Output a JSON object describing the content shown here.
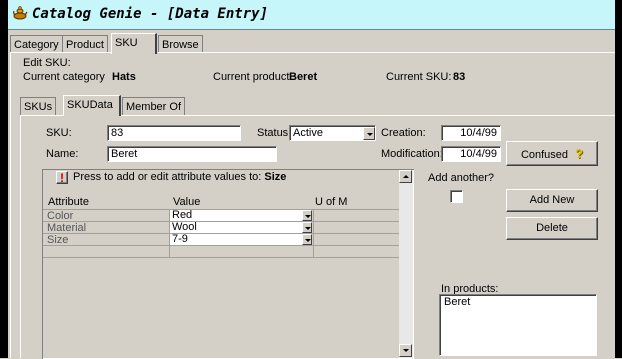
{
  "window": {
    "title": "Catalog Genie - [Data Entry]"
  },
  "main_tabs": [
    "Category",
    "Product",
    "SKU",
    "Browse"
  ],
  "edit_sku": {
    "heading": "Edit SKU:",
    "category_label": "Current category",
    "category_value": "Hats",
    "product_label": "Current product",
    "product_value": "Beret",
    "sku_label": "Current SKU:",
    "sku_value": "83"
  },
  "sub_tabs": [
    "SKUs",
    "SKUData",
    "Member Of"
  ],
  "form": {
    "sku_label": "SKU:",
    "sku_value": "83",
    "name_label": "Name:",
    "name_value": "Beret",
    "status_label": "Status:",
    "status_value": "Active",
    "creation_label": "Creation:",
    "creation_value": "10/4/99",
    "modification_label": "Modification:",
    "modification_value": "10/4/99",
    "confused_label": "Confused",
    "confused_icon": "question-mark-icon"
  },
  "attributes": {
    "prompt_prefix": "Press to add or edit attribute values to:",
    "prompt_target": "Size",
    "columns": [
      "Attribute",
      "Value",
      "U of M"
    ],
    "rows": [
      {
        "attribute": "Color",
        "value": "Red",
        "uom": ""
      },
      {
        "attribute": "Material",
        "value": "Wool",
        "uom": ""
      },
      {
        "attribute": "Size",
        "value": "7-9",
        "uom": ""
      }
    ]
  },
  "side": {
    "add_another_label": "Add another?",
    "add_new_label": "Add New",
    "delete_label": "Delete",
    "in_products_label": "In products:",
    "in_products_items": [
      "Beret"
    ]
  },
  "colors": {
    "titlebar_bg": "#c6f5fa",
    "window_bg": "#d4d0c8",
    "alert_red": "#cc0000"
  }
}
